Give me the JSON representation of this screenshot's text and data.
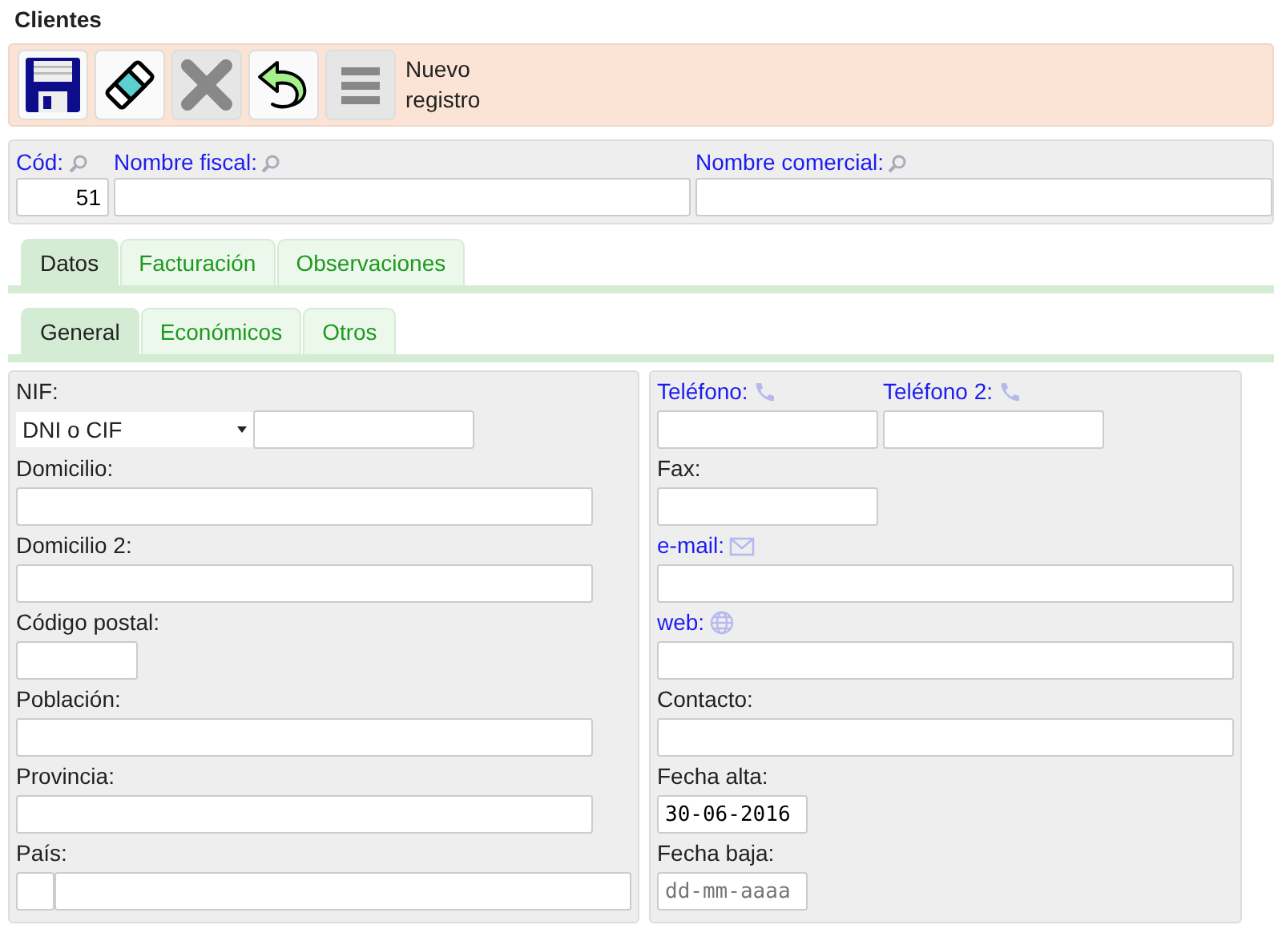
{
  "window": {
    "title": "Clientes"
  },
  "toolbar": {
    "buttons": [
      {
        "kind": "save",
        "disabled": false
      },
      {
        "kind": "clear",
        "disabled": false
      },
      {
        "kind": "delete",
        "disabled": true
      },
      {
        "kind": "undo",
        "disabled": false
      },
      {
        "kind": "menu",
        "disabled": true
      }
    ],
    "status": "Nuevo registro"
  },
  "header_fields": [
    {
      "label": "Cód:",
      "link": true,
      "icon": {
        "kind": "search"
      },
      "kind": "code",
      "value": "51"
    },
    {
      "label": "Nombre fiscal:",
      "link": true,
      "icon": {
        "kind": "search"
      },
      "kind": "name"
    },
    {
      "label": "Nombre comercial:",
      "link": true,
      "icon": {
        "kind": "search"
      },
      "kind": "name"
    }
  ],
  "tabs": [
    {
      "label": "Datos",
      "selected": true
    },
    {
      "label": "Facturación",
      "selected": false
    },
    {
      "label": "Observaciones",
      "selected": false
    }
  ],
  "subtabs": [
    {
      "label": "General",
      "selected": true
    },
    {
      "label": "Económicos",
      "selected": false
    },
    {
      "label": "Otros",
      "selected": false
    }
  ],
  "panels": [
    {
      "rows": [
        [
          {
            "label": "NIF:",
            "link": false,
            "kind": "select_input",
            "option": "DNI o CIF"
          }
        ],
        [
          {
            "label": "Domicilio:",
            "link": false,
            "kind": "wide"
          }
        ],
        [
          {
            "label": "Domicilio 2:",
            "link": false,
            "kind": "wide"
          }
        ],
        [
          {
            "label": "Código postal:",
            "link": false,
            "kind": "tiny"
          }
        ],
        [
          {
            "label": "Población:",
            "link": false,
            "kind": "wide"
          }
        ],
        [
          {
            "label": "Provincia:",
            "link": false,
            "kind": "wide"
          }
        ],
        [
          {
            "label": "País:",
            "link": false,
            "kind": "pair"
          }
        ]
      ]
    },
    {
      "rows": [
        [
          {
            "label": "Teléfono:",
            "link": true,
            "icon": {
              "kind": "phone"
            },
            "kind": "short"
          },
          {
            "label": "Teléfono 2:",
            "link": true,
            "icon": {
              "kind": "phone"
            },
            "kind": "short"
          }
        ],
        [
          {
            "label": "Fax:",
            "link": false,
            "kind": "short"
          }
        ],
        [
          {
            "label": "e-mail:",
            "link": true,
            "icon": {
              "kind": "email"
            },
            "kind": "wide"
          }
        ],
        [
          {
            "label": "web:",
            "link": true,
            "icon": {
              "kind": "web"
            },
            "kind": "wide"
          }
        ],
        [
          {
            "label": "Contacto:",
            "link": false,
            "kind": "wide"
          }
        ],
        [
          {
            "label": "Fecha alta:",
            "link": false,
            "kind": "date",
            "value": "30-06-2016"
          }
        ],
        [
          {
            "label": "Fecha baja:",
            "link": false,
            "kind": "date",
            "placeholder": "dd-mm-aaaa"
          }
        ]
      ]
    }
  ]
}
